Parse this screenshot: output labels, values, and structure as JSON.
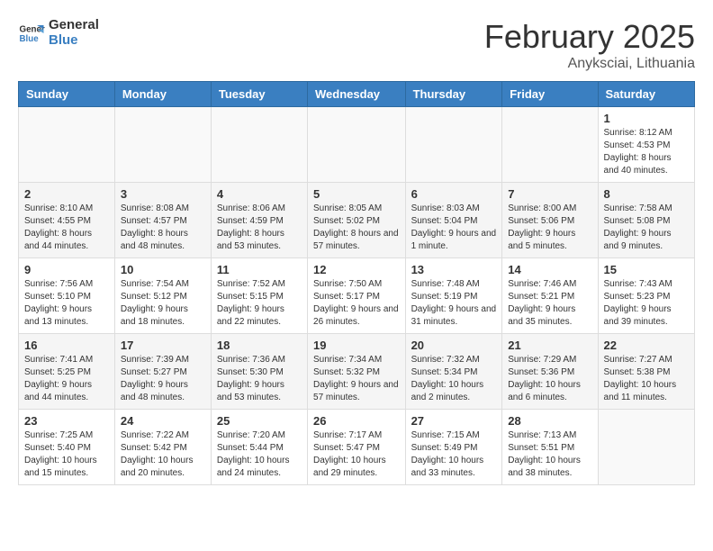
{
  "logo": {
    "line1": "General",
    "line2": "Blue"
  },
  "header": {
    "month": "February 2025",
    "location": "Anyksciai, Lithuania"
  },
  "weekdays": [
    "Sunday",
    "Monday",
    "Tuesday",
    "Wednesday",
    "Thursday",
    "Friday",
    "Saturday"
  ],
  "weeks": [
    [
      {
        "day": "",
        "info": ""
      },
      {
        "day": "",
        "info": ""
      },
      {
        "day": "",
        "info": ""
      },
      {
        "day": "",
        "info": ""
      },
      {
        "day": "",
        "info": ""
      },
      {
        "day": "",
        "info": ""
      },
      {
        "day": "1",
        "info": "Sunrise: 8:12 AM\nSunset: 4:53 PM\nDaylight: 8 hours and 40 minutes."
      }
    ],
    [
      {
        "day": "2",
        "info": "Sunrise: 8:10 AM\nSunset: 4:55 PM\nDaylight: 8 hours and 44 minutes."
      },
      {
        "day": "3",
        "info": "Sunrise: 8:08 AM\nSunset: 4:57 PM\nDaylight: 8 hours and 48 minutes."
      },
      {
        "day": "4",
        "info": "Sunrise: 8:06 AM\nSunset: 4:59 PM\nDaylight: 8 hours and 53 minutes."
      },
      {
        "day": "5",
        "info": "Sunrise: 8:05 AM\nSunset: 5:02 PM\nDaylight: 8 hours and 57 minutes."
      },
      {
        "day": "6",
        "info": "Sunrise: 8:03 AM\nSunset: 5:04 PM\nDaylight: 9 hours and 1 minute."
      },
      {
        "day": "7",
        "info": "Sunrise: 8:00 AM\nSunset: 5:06 PM\nDaylight: 9 hours and 5 minutes."
      },
      {
        "day": "8",
        "info": "Sunrise: 7:58 AM\nSunset: 5:08 PM\nDaylight: 9 hours and 9 minutes."
      }
    ],
    [
      {
        "day": "9",
        "info": "Sunrise: 7:56 AM\nSunset: 5:10 PM\nDaylight: 9 hours and 13 minutes."
      },
      {
        "day": "10",
        "info": "Sunrise: 7:54 AM\nSunset: 5:12 PM\nDaylight: 9 hours and 18 minutes."
      },
      {
        "day": "11",
        "info": "Sunrise: 7:52 AM\nSunset: 5:15 PM\nDaylight: 9 hours and 22 minutes."
      },
      {
        "day": "12",
        "info": "Sunrise: 7:50 AM\nSunset: 5:17 PM\nDaylight: 9 hours and 26 minutes."
      },
      {
        "day": "13",
        "info": "Sunrise: 7:48 AM\nSunset: 5:19 PM\nDaylight: 9 hours and 31 minutes."
      },
      {
        "day": "14",
        "info": "Sunrise: 7:46 AM\nSunset: 5:21 PM\nDaylight: 9 hours and 35 minutes."
      },
      {
        "day": "15",
        "info": "Sunrise: 7:43 AM\nSunset: 5:23 PM\nDaylight: 9 hours and 39 minutes."
      }
    ],
    [
      {
        "day": "16",
        "info": "Sunrise: 7:41 AM\nSunset: 5:25 PM\nDaylight: 9 hours and 44 minutes."
      },
      {
        "day": "17",
        "info": "Sunrise: 7:39 AM\nSunset: 5:27 PM\nDaylight: 9 hours and 48 minutes."
      },
      {
        "day": "18",
        "info": "Sunrise: 7:36 AM\nSunset: 5:30 PM\nDaylight: 9 hours and 53 minutes."
      },
      {
        "day": "19",
        "info": "Sunrise: 7:34 AM\nSunset: 5:32 PM\nDaylight: 9 hours and 57 minutes."
      },
      {
        "day": "20",
        "info": "Sunrise: 7:32 AM\nSunset: 5:34 PM\nDaylight: 10 hours and 2 minutes."
      },
      {
        "day": "21",
        "info": "Sunrise: 7:29 AM\nSunset: 5:36 PM\nDaylight: 10 hours and 6 minutes."
      },
      {
        "day": "22",
        "info": "Sunrise: 7:27 AM\nSunset: 5:38 PM\nDaylight: 10 hours and 11 minutes."
      }
    ],
    [
      {
        "day": "23",
        "info": "Sunrise: 7:25 AM\nSunset: 5:40 PM\nDaylight: 10 hours and 15 minutes."
      },
      {
        "day": "24",
        "info": "Sunrise: 7:22 AM\nSunset: 5:42 PM\nDaylight: 10 hours and 20 minutes."
      },
      {
        "day": "25",
        "info": "Sunrise: 7:20 AM\nSunset: 5:44 PM\nDaylight: 10 hours and 24 minutes."
      },
      {
        "day": "26",
        "info": "Sunrise: 7:17 AM\nSunset: 5:47 PM\nDaylight: 10 hours and 29 minutes."
      },
      {
        "day": "27",
        "info": "Sunrise: 7:15 AM\nSunset: 5:49 PM\nDaylight: 10 hours and 33 minutes."
      },
      {
        "day": "28",
        "info": "Sunrise: 7:13 AM\nSunset: 5:51 PM\nDaylight: 10 hours and 38 minutes."
      },
      {
        "day": "",
        "info": ""
      }
    ]
  ]
}
